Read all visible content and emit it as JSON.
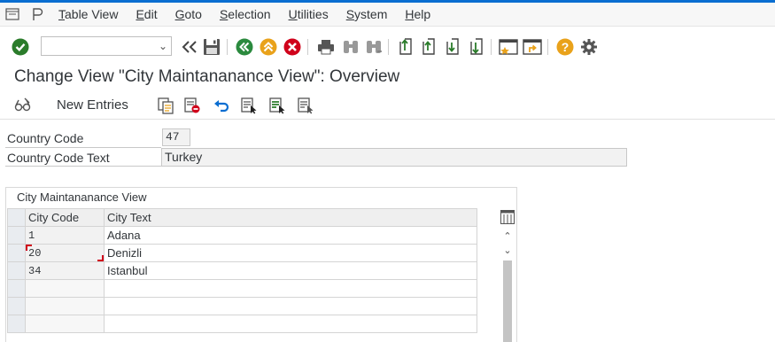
{
  "menu": {
    "items": [
      {
        "label": "Table View",
        "u": "T",
        "rest": "able View"
      },
      {
        "label": "Edit",
        "u": "E",
        "rest": "dit"
      },
      {
        "label": "Goto",
        "u": "G",
        "rest": "oto"
      },
      {
        "label": "Selection",
        "u": "S",
        "rest": "election"
      },
      {
        "label": "Utilities",
        "u": "U",
        "rest": "tilities"
      },
      {
        "label": "System",
        "u": "S",
        "rest": "ystem"
      },
      {
        "label": "Help",
        "u": "H",
        "rest": "elp"
      }
    ]
  },
  "toolbar": {
    "command_field_value": ""
  },
  "page": {
    "title": "Change View \"City Maintananance View\": Overview"
  },
  "app_toolbar": {
    "new_entries_label": "New Entries"
  },
  "fields": {
    "country_code_label": "Country Code",
    "country_code_value": "47",
    "country_code_text_label": "Country Code Text",
    "country_code_text_value": "Turkey"
  },
  "table": {
    "title": "City Maintananance View",
    "columns": [
      "City Code",
      "City Text"
    ],
    "rows": [
      {
        "code": "1",
        "text": "Adana"
      },
      {
        "code": "20",
        "text": "Denizli"
      },
      {
        "code": "34",
        "text": "Istanbul"
      }
    ]
  },
  "colors": {
    "accent": "#0a6ed1",
    "ok_green": "#2b7c2b",
    "cancel_red": "#d0021b",
    "nav_green": "#2b8a3e",
    "nav_orange": "#e9a21b",
    "help_orange": "#e9a21b"
  }
}
